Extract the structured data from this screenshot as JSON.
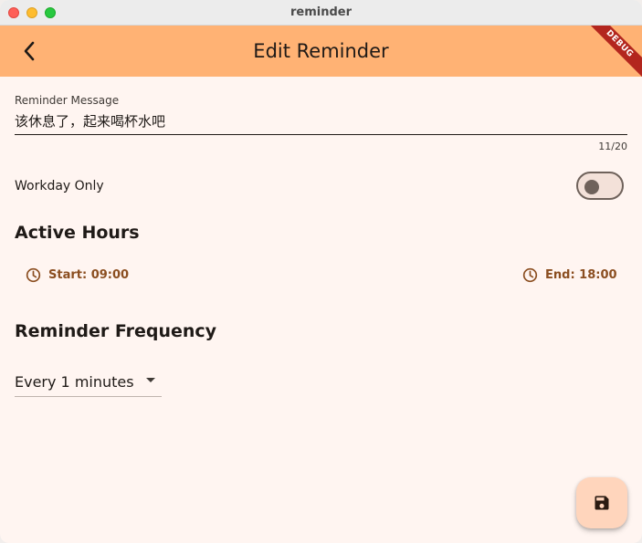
{
  "window": {
    "title": "reminder"
  },
  "appbar": {
    "title": "Edit Reminder",
    "debug_banner": "DEBUG",
    "back_icon": "arrow-back-icon"
  },
  "form": {
    "message_label": "Reminder Message",
    "message_value": "该休息了，起来喝杯水吧",
    "message_counter": "11/20",
    "workday_label": "Workday Only",
    "workday_only": false
  },
  "active_hours": {
    "title": "Active Hours",
    "start_label": "Start: 09:00",
    "end_label": "End: 18:00",
    "icon": "clock-icon"
  },
  "frequency": {
    "title": "Reminder Frequency",
    "selected": "Every 1 minutes"
  },
  "fab": {
    "icon": "save-icon"
  },
  "colors": {
    "appbar": "#ffb274",
    "background": "#fff5f1",
    "accent_text": "#8b4e20",
    "fab": "#ffd5bc"
  }
}
